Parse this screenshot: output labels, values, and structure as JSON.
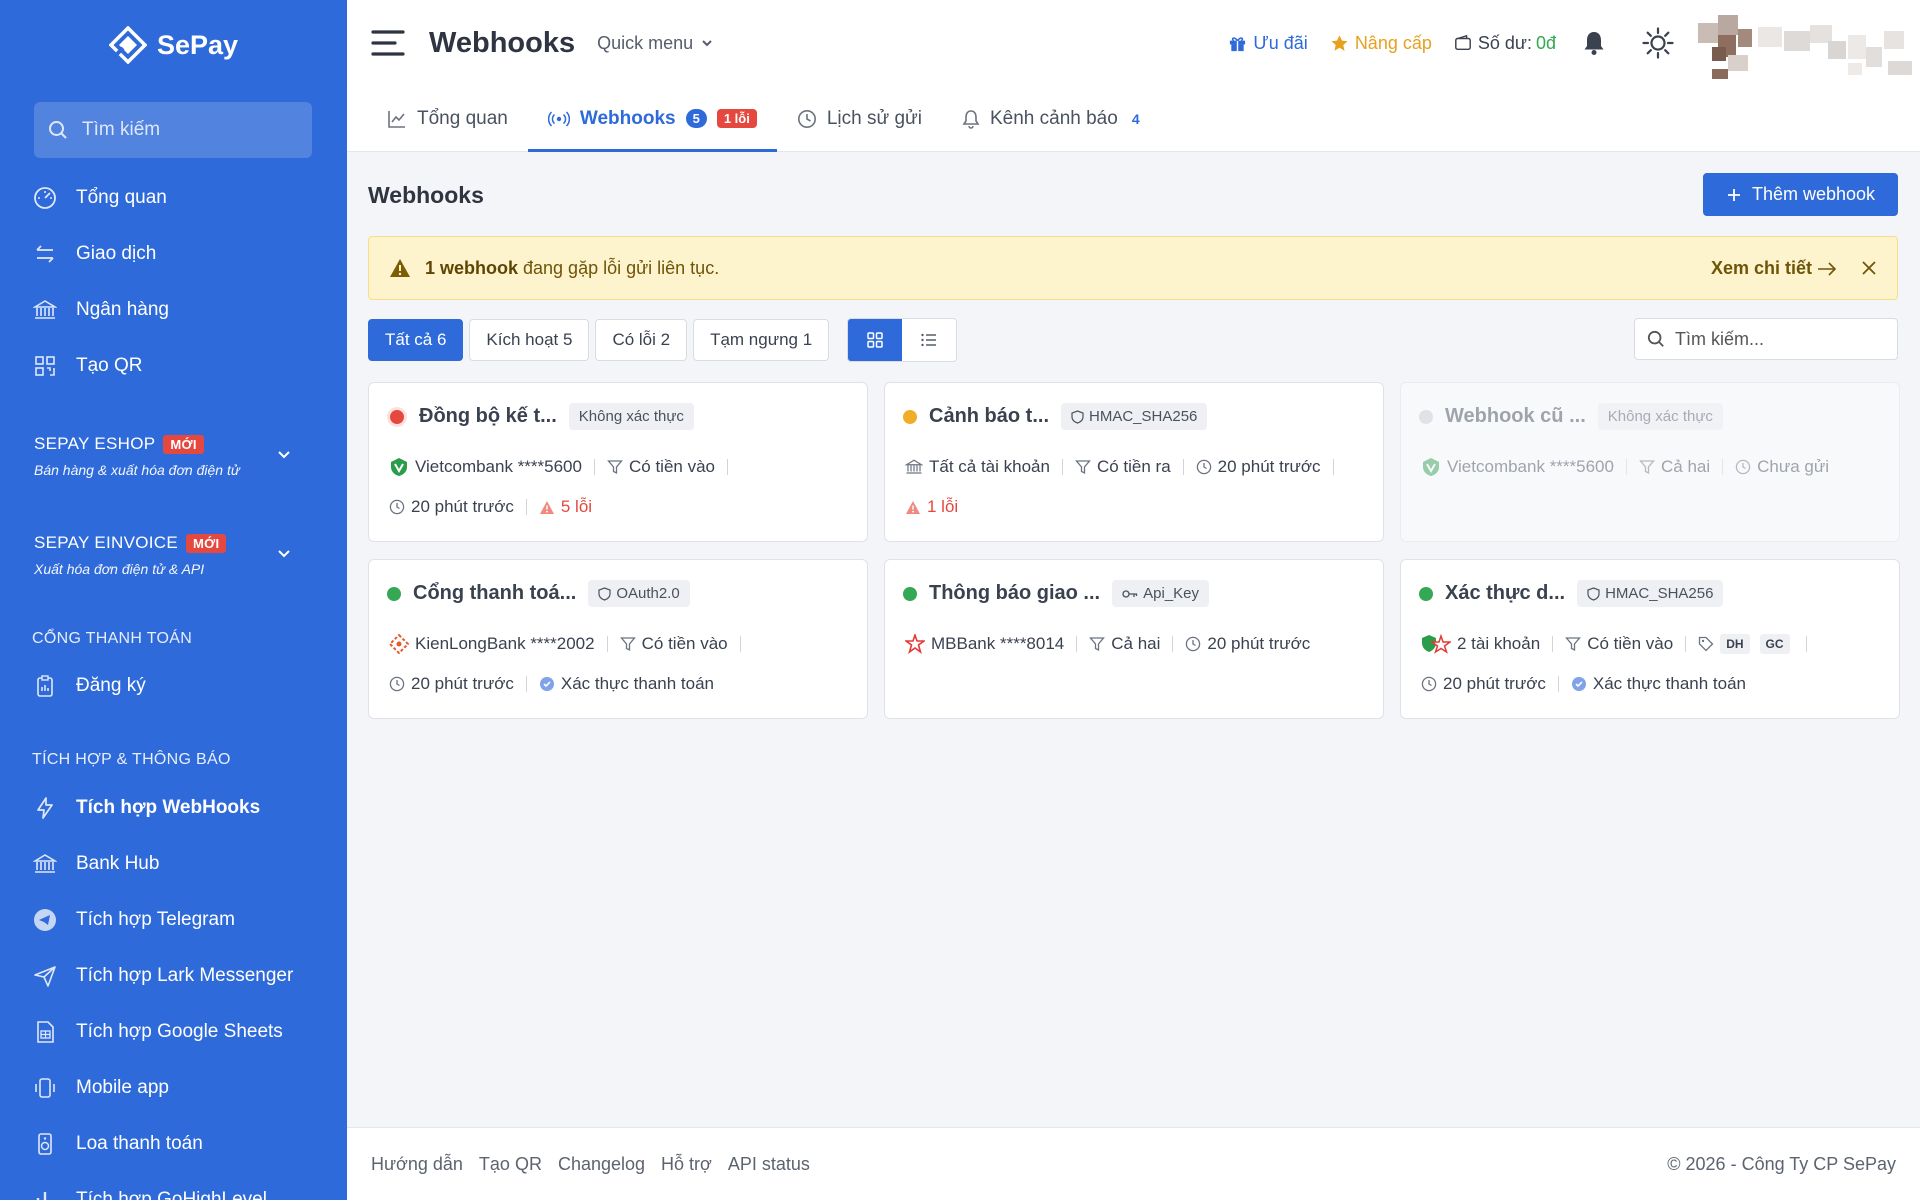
{
  "brand": {
    "name": "SePay"
  },
  "sidebar": {
    "search_placeholder": "Tìm kiếm",
    "items": [
      {
        "label": "Tổng quan",
        "icon": "dashboard-icon"
      },
      {
        "label": "Giao dịch",
        "icon": "transfer-icon"
      },
      {
        "label": "Ngân hàng",
        "icon": "bank-icon"
      },
      {
        "label": "Tạo QR",
        "icon": "qr-icon"
      }
    ],
    "eshop": {
      "title": "SEPAY ESHOP",
      "badge": "MỚI",
      "subtitle": "Bán hàng & xuất hóa đơn điện tử"
    },
    "einvoice": {
      "title": "SEPAY EINVOICE",
      "badge": "MỚI",
      "subtitle": "Xuất hóa đơn điện tử & API"
    },
    "payment_heading": "CỔNG THANH TOÁN",
    "payment_items": [
      {
        "label": "Đăng ký",
        "icon": "form-icon"
      }
    ],
    "integration_heading": "TÍCH HỢP & THÔNG BÁO",
    "integration_items": [
      {
        "label": "Tích hợp WebHooks",
        "icon": "bolt-icon",
        "active": true
      },
      {
        "label": "Bank Hub",
        "icon": "bank-icon"
      },
      {
        "label": "Tích hợp Telegram",
        "icon": "telegram-icon"
      },
      {
        "label": "Tích hợp Lark Messenger",
        "icon": "send-icon"
      },
      {
        "label": "Tích hợp Google Sheets",
        "icon": "sheet-icon"
      },
      {
        "label": "Mobile app",
        "icon": "phone-vibrate-icon"
      },
      {
        "label": "Loa thanh toán",
        "icon": "speaker-icon"
      },
      {
        "label": "Tích hợp GoHighLevel",
        "icon": "chart-icon"
      }
    ]
  },
  "topbar": {
    "title": "Webhooks",
    "quick_menu": "Quick menu",
    "promo": "Ưu đãi",
    "upgrade": "Nâng cấp",
    "balance_label": "Số dư:",
    "balance_value": "0đ"
  },
  "tabs": [
    {
      "label": "Tổng quan",
      "icon": "chart-line-icon"
    },
    {
      "label": "Webhooks",
      "icon": "broadcast-icon",
      "count": "5",
      "error": "1 lỗi",
      "active": true
    },
    {
      "label": "Lịch sử gửi",
      "icon": "clock-icon"
    },
    {
      "label": "Kênh cảnh báo",
      "icon": "bell-icon",
      "count": "4"
    }
  ],
  "main": {
    "title": "Webhooks",
    "add_button": "Thêm webhook",
    "alert": {
      "bold": "1 webhook",
      "text": "đang gặp lỗi gửi liên tục.",
      "link": "Xem chi tiết"
    },
    "filters": [
      "Tất cả 6",
      "Kích hoạt 5",
      "Có lỗi 2",
      "Tạm ngưng 1"
    ],
    "search_placeholder": "Tìm kiếm..."
  },
  "cards": [
    {
      "name": "Đồng bộ kế t...",
      "status_color": "#e5483e",
      "auth": "Không xác thực",
      "bank": "Vietcombank ****5600",
      "filter": "Có tiền vào",
      "time": "20 phút trước",
      "errors": "5 lỗi"
    },
    {
      "name": "Cảnh báo t...",
      "status_color": "#f0ad28",
      "auth": "HMAC_SHA256",
      "bank": "Tất cả tài khoản",
      "filter": "Có tiền ra",
      "time": "20 phút trước",
      "errors": "1 lỗi"
    },
    {
      "name": "Webhook cũ ...",
      "status_color": "#d4d8de",
      "auth": "Không xác thực",
      "bank": "Vietcombank ****5600",
      "filter": "Cả hai",
      "time": "Chưa gửi"
    },
    {
      "name": "Cổng thanh toá...",
      "status_color": "#34a853",
      "auth": "OAuth2.0",
      "bank": "KienLongBank ****2002",
      "filter": "Có tiền vào",
      "time": "20 phút trước",
      "verify": "Xác thực thanh toán"
    },
    {
      "name": "Thông báo giao ...",
      "status_color": "#34a853",
      "auth": "Api_Key",
      "bank": "MBBank ****8014",
      "filter": "Cả hai",
      "time": "20 phút trước"
    },
    {
      "name": "Xác thực d...",
      "status_color": "#34a853",
      "auth": "HMAC_SHA256",
      "bank": "2 tài khoản",
      "filter": "Có tiền vào",
      "tags": [
        "DH",
        "GC"
      ],
      "time": "20 phút trước",
      "verify": "Xác thực thanh toán"
    }
  ],
  "footer": {
    "links": [
      "Hướng dẫn",
      "Tạo QR",
      "Changelog",
      "Hỗ trợ",
      "API status"
    ],
    "copyright": "© 2026 - Công Ty CP SePay"
  },
  "colors": {
    "primary": "#2e6ad9",
    "sidebar": "#2e6ad9",
    "danger": "#e5483e",
    "warning": "#f0ad28",
    "success": "#34a853",
    "promo": "#2e6ad9",
    "upgrade": "#e6a11f",
    "balance": "#34a853"
  }
}
